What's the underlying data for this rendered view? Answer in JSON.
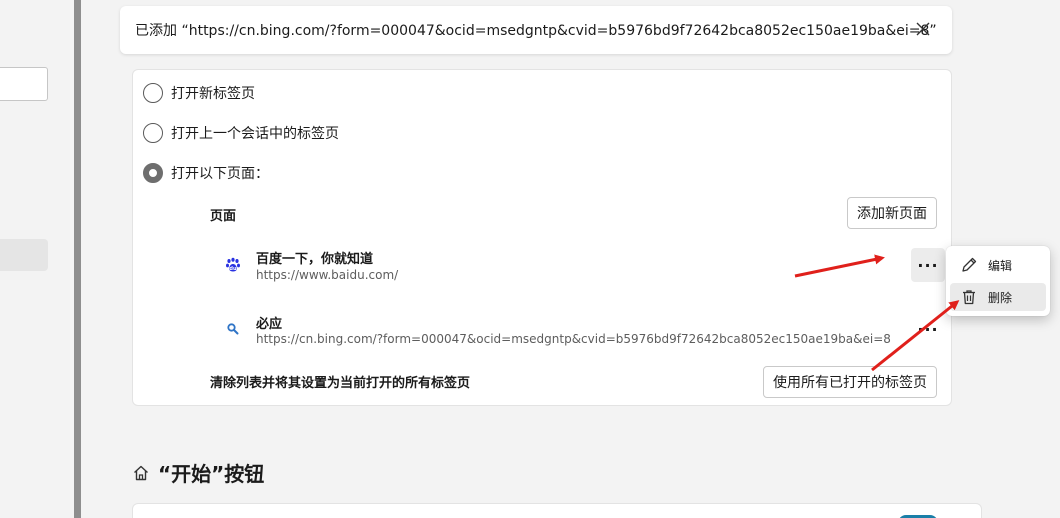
{
  "notification": {
    "text": "已添加 “https://cn.bing.com/?form=000047&ocid=msedgntp&cvid=b5976bd9f72642bca8052ec150ae19ba&ei=8”"
  },
  "startup": {
    "options": [
      {
        "label": "打开新标签页",
        "checked": false
      },
      {
        "label": "打开上一个会话中的标签页",
        "checked": false
      },
      {
        "label": "打开以下页面：",
        "checked": true
      }
    ],
    "pages_label": "页面",
    "add_page_button": "添加新页面",
    "pages": [
      {
        "title": "百度一下，你就知道",
        "url": "https://www.baidu.com/",
        "icon": "baidu-icon",
        "more": "···"
      },
      {
        "title": "必应",
        "url": "https://cn.bing.com/?form=000047&ocid=msedgntp&cvid=b5976bd9f72642bca8052ec150ae19ba&ei=8",
        "icon": "bing-search-icon",
        "more": "···"
      }
    ],
    "clear_label": "清除列表并将其设置为当前打开的所有标签页",
    "use_open_tabs_button": "使用所有已打开的标签页"
  },
  "context_menu": {
    "items": [
      {
        "label": "编辑",
        "icon": "pencil-icon"
      },
      {
        "label": "删除",
        "icon": "trash-icon",
        "hovered": true
      }
    ]
  },
  "start_button_section": {
    "title": "“开始”按钮",
    "icon": "home-icon"
  },
  "colors": {
    "annotation_arrow": "#e0201b",
    "baidu_blue": "#2932e1",
    "bing_blue": "#2f74c6",
    "toggle_accent": "#1a7fa8"
  }
}
